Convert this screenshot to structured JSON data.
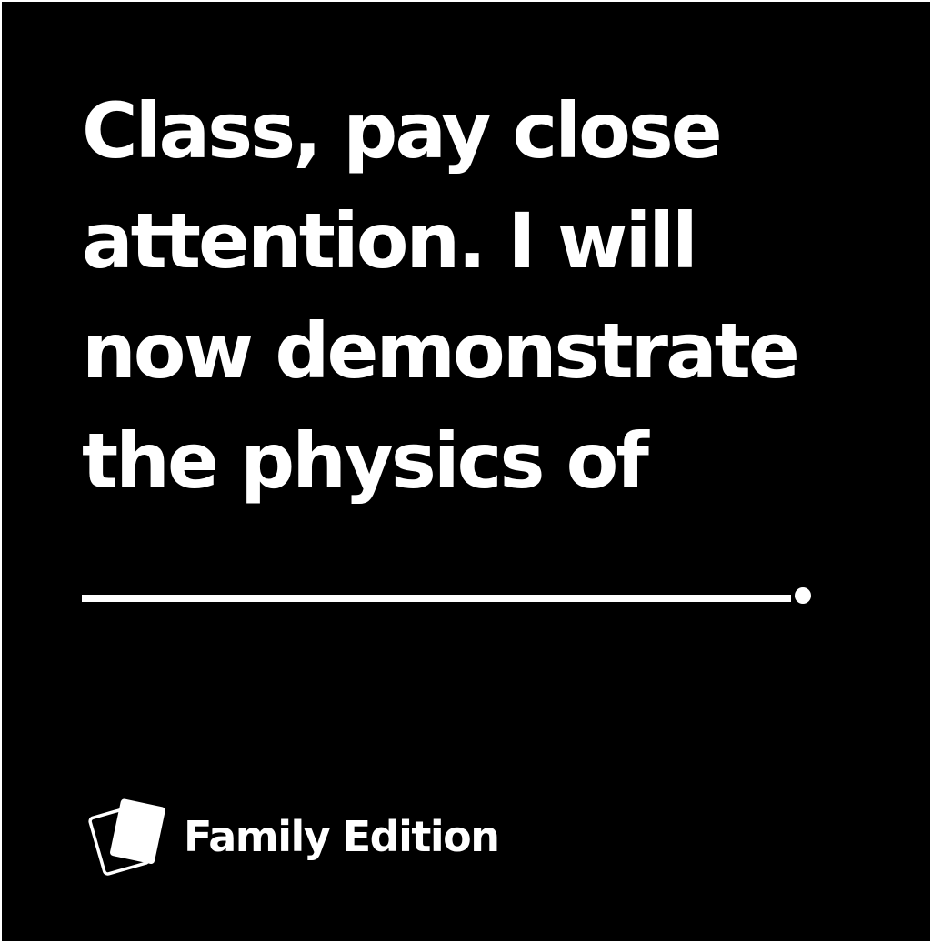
{
  "card": {
    "prompt_lines": [
      "Class, pay close",
      "attention. I will",
      "now demonstrate",
      "the physics of"
    ],
    "background_color": "#000000",
    "text_color": "#ffffff"
  },
  "footer": {
    "icon": "cards-icon",
    "edition_label": "Family Edition"
  }
}
